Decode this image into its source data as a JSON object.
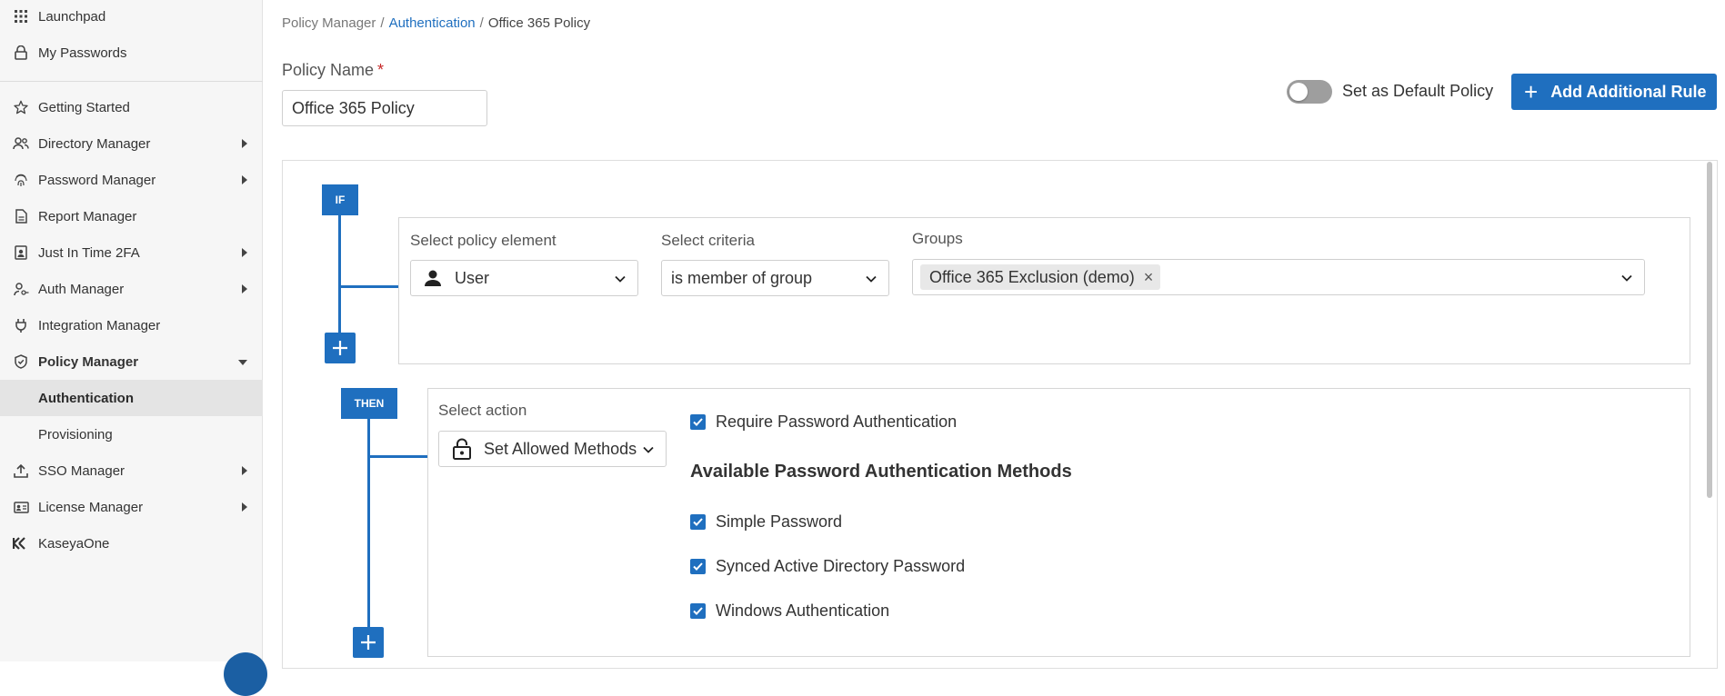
{
  "sidebar": {
    "items": [
      {
        "label": "Launchpad",
        "icon": "grid-icon"
      },
      {
        "label": "My Passwords",
        "icon": "lock-icon"
      },
      {
        "label": "Getting Started",
        "icon": "star-icon"
      },
      {
        "label": "Directory Manager",
        "icon": "users-icon"
      },
      {
        "label": "Password Manager",
        "icon": "fingerprint-icon"
      },
      {
        "label": "Report Manager",
        "icon": "document-icon"
      },
      {
        "label": "Just In Time 2FA",
        "icon": "badge-icon"
      },
      {
        "label": "Auth Manager",
        "icon": "user-key-icon"
      },
      {
        "label": "Integration Manager",
        "icon": "plug-icon"
      },
      {
        "label": "Policy Manager",
        "icon": "shield-icon"
      },
      {
        "label": "SSO Manager",
        "icon": "upload-icon"
      },
      {
        "label": "License Manager",
        "icon": "id-card-icon"
      },
      {
        "label": "KaseyaOne",
        "icon": "kaseya-icon"
      }
    ],
    "subitems": [
      {
        "label": "Authentication",
        "active": true
      },
      {
        "label": "Provisioning",
        "active": false
      }
    ]
  },
  "breadcrumb": {
    "root": "Policy Manager",
    "section": "Authentication",
    "current": "Office 365 Policy",
    "separator": "/"
  },
  "policy_name": {
    "label": "Policy Name",
    "required_mark": "*",
    "value": "Office 365 Policy"
  },
  "default_toggle": {
    "label": "Set as Default Policy",
    "on": false
  },
  "add_rule_button": {
    "plus": "+",
    "label": "Add Additional Rule"
  },
  "if_block": {
    "tag": "IF",
    "element_label": "Select policy element",
    "element_value": "User",
    "criteria_label": "Select criteria",
    "criteria_value": "is member of group",
    "groups_label": "Groups",
    "groups": [
      "Office 365 Exclusion (demo)"
    ],
    "remove_glyph": "×"
  },
  "then_block": {
    "tag": "THEN",
    "action_label": "Select action",
    "action_value": "Set Allowed Methods",
    "require_password": "Require Password Authentication",
    "methods_title": "Available Password Authentication Methods",
    "methods": [
      {
        "label": "Simple Password",
        "checked": true
      },
      {
        "label": "Synced Active Directory Password",
        "checked": true
      },
      {
        "label": "Windows Authentication",
        "checked": true
      }
    ]
  },
  "colors": {
    "accent": "#1f6fbf",
    "sidebar_bg": "#f6f6f6",
    "active_item_bg": "#e4e4e4",
    "required": "#c62828"
  }
}
